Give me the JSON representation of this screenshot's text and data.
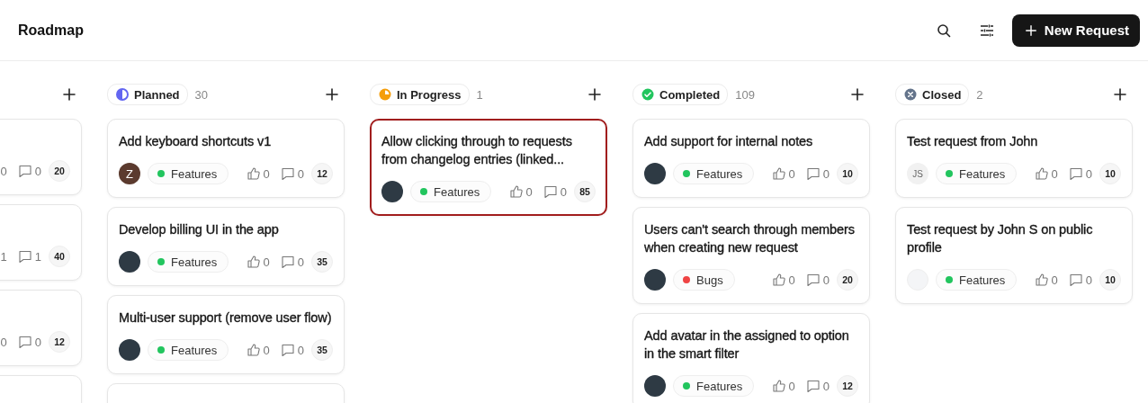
{
  "header": {
    "title": "Roadmap",
    "new_button": "New Request"
  },
  "columns": [
    {
      "cards": [
        {
          "selected": false,
          "votes": "0",
          "comments": "0",
          "badge": "20"
        },
        {
          "selected": false,
          "votes": "1",
          "comments": "1",
          "badge": "40"
        },
        {
          "selected": false,
          "votes": "0",
          "comments": "0",
          "badge": "12"
        },
        {
          "selected": false
        }
      ]
    },
    {
      "name": "Planned",
      "kind": "planned",
      "count": "30",
      "cards": [
        {
          "selected": false,
          "title": "Add keyboard shortcuts v1",
          "avatar": {
            "kind": "letter",
            "text": "Z"
          },
          "tag": {
            "label": "Features",
            "color": "#22c55e"
          },
          "votes": "0",
          "comments": "0",
          "badge": "12"
        },
        {
          "selected": false,
          "title": "Develop billing UI in the app",
          "avatar": {
            "kind": "photo"
          },
          "tag": {
            "label": "Features",
            "color": "#22c55e"
          },
          "votes": "0",
          "comments": "0",
          "badge": "35"
        },
        {
          "selected": false,
          "title": "Multi-user support (remove user flow)",
          "avatar": {
            "kind": "photo"
          },
          "tag": {
            "label": "Features",
            "color": "#22c55e"
          },
          "votes": "0",
          "comments": "0",
          "badge": "35"
        },
        {
          "selected": false
        }
      ]
    },
    {
      "name": "In Progress",
      "kind": "in_progress",
      "count": "1",
      "cards": [
        {
          "selected": true,
          "title": "Allow clicking through to requests from changelog entries (linked...",
          "avatar": {
            "kind": "photo"
          },
          "tag": {
            "label": "Features",
            "color": "#22c55e"
          },
          "votes": "0",
          "comments": "0",
          "badge": "85"
        }
      ]
    },
    {
      "name": "Completed",
      "kind": "completed",
      "count": "109",
      "cards": [
        {
          "selected": false,
          "title": "Add support for internal notes",
          "avatar": {
            "kind": "photo"
          },
          "tag": {
            "label": "Features",
            "color": "#22c55e"
          },
          "votes": "0",
          "comments": "0",
          "badge": "10"
        },
        {
          "selected": false,
          "title": "Users can't search through members when creating new request",
          "avatar": {
            "kind": "photo"
          },
          "tag": {
            "label": "Bugs",
            "color": "#ef4444"
          },
          "votes": "0",
          "comments": "0",
          "badge": "20"
        },
        {
          "selected": false,
          "title": "Add avatar in the assigned to option in the smart filter",
          "avatar": {
            "kind": "photo"
          },
          "tag": {
            "label": "Features",
            "color": "#22c55e"
          },
          "votes": "0",
          "comments": "0",
          "badge": "12"
        }
      ]
    },
    {
      "name": "Closed",
      "kind": "closed",
      "count": "2",
      "cards": [
        {
          "selected": false,
          "title": "Test request from John",
          "avatar": {
            "kind": "initials",
            "text": "JS"
          },
          "tag": {
            "label": "Features",
            "color": "#22c55e"
          },
          "votes": "0",
          "comments": "0",
          "badge": "10"
        },
        {
          "selected": false,
          "title": "Test request by John S on public profile",
          "avatar": {
            "kind": "image"
          },
          "tag": {
            "label": "Features",
            "color": "#22c55e"
          },
          "votes": "0",
          "comments": "0",
          "badge": "10"
        }
      ]
    }
  ]
}
